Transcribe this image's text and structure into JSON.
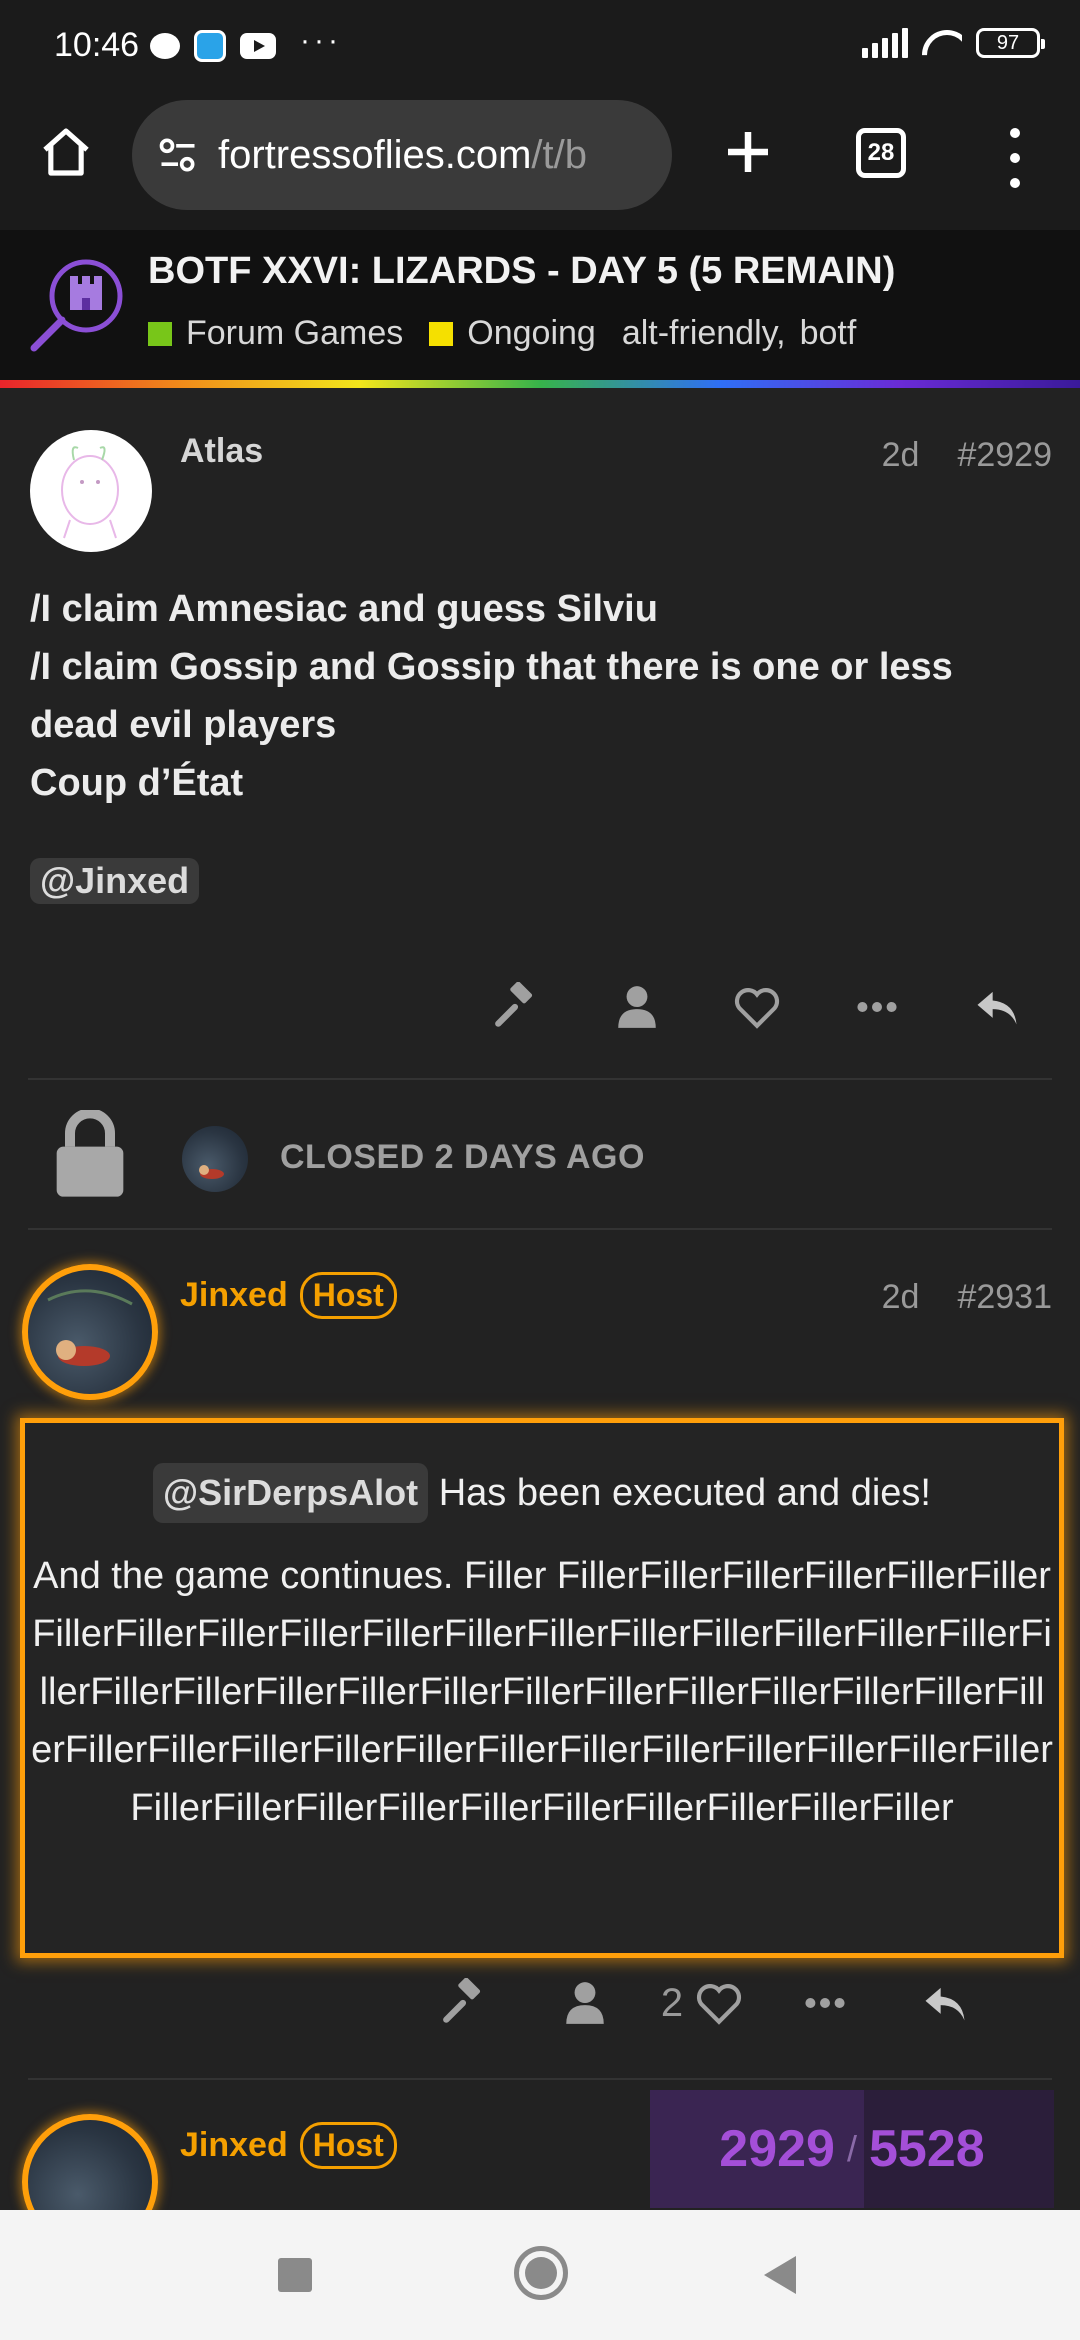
{
  "status_bar": {
    "time": "10:46",
    "more": "···",
    "battery": "97"
  },
  "browser": {
    "url_host": "fortressoflies.com",
    "url_path": "/t/b",
    "tab_count": "28"
  },
  "topic": {
    "title": "BOTF XXVI: LIZARDS - DAY 5 (5 REMAIN)",
    "category": "Forum Games",
    "category_color": "#78c619",
    "status": "Ongoing",
    "status_color": "#f5e000",
    "tags": [
      "alt-friendly,",
      "botf"
    ]
  },
  "post_2929": {
    "username": "Atlas",
    "age": "2d",
    "number": "#2929",
    "lines": [
      "/I claim Amnesiac and guess Silviu",
      "/I claim Gossip and Gossip that there is one or less dead evil players",
      "Coup d’État"
    ],
    "mention": "@Jinxed"
  },
  "closed_notice": {
    "text": "CLOSED 2 DAYS AGO"
  },
  "post_2931": {
    "username": "Jinxed",
    "badge": "Host",
    "age": "2d",
    "number": "#2931",
    "mention": "@SirDerpsAlot",
    "line1": "Has been executed and dies!",
    "line2": "And the game continues. Filler FillerFillerFillerFillerFillerFillerFillerFillerFillerFillerFillerFillerFillerFillerFillerFillerFillerFillerFillerFillerFillerFillerFillerFillerFillerFillerFillerFillerFillerFillerFillerFillerFillerFillerFillerFillerFillerFillerFillerFillerFillerFillerFillerFillerFillerFillerFillerFillerFillerFillerFillerFillerFiller",
    "like_count": "2"
  },
  "post_next": {
    "username": "Jinxed",
    "badge": "Host"
  },
  "progress": {
    "current": "2929",
    "separator": "/",
    "total": "5528",
    "fraction": 0.53
  },
  "colors": {
    "host_accent": "#ff9f0a",
    "progress_purple": "#a44fd8"
  }
}
